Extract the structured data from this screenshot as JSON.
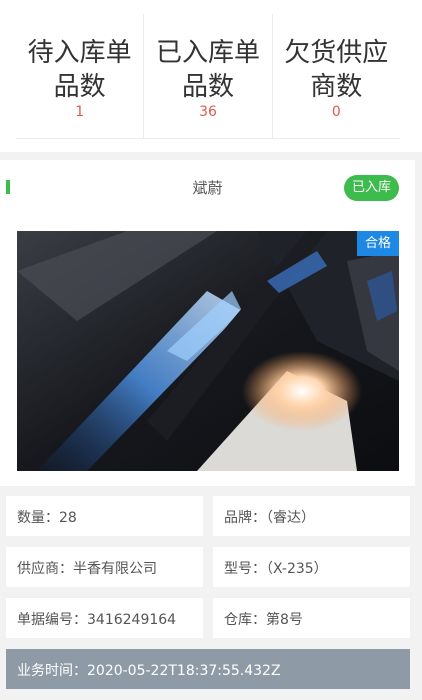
{
  "stats": [
    {
      "label": "待入库单品数",
      "value": "1"
    },
    {
      "label": "已入库单品数",
      "value": "36"
    },
    {
      "label": "欠货供应商数",
      "value": "0"
    }
  ],
  "product": {
    "name": "斌蔚",
    "status": "已入库",
    "qc_tag": "合格"
  },
  "fields": {
    "quantity": "数量：28",
    "brand": "品牌：（睿达）",
    "supplier": "供应商：半香有限公司",
    "model": "型号：（X-235）",
    "doc_no": "单据编号：3416249164",
    "warehouse": "仓库：第8号",
    "business_time": "业务时间：2020-05-22T18:37:55.432Z"
  },
  "colors": {
    "accent_green": "#3dbb4c",
    "stat_value_red": "#e05a4a",
    "qc_blue": "#1e88e5",
    "time_bar_gray": "#8e9aa5"
  }
}
